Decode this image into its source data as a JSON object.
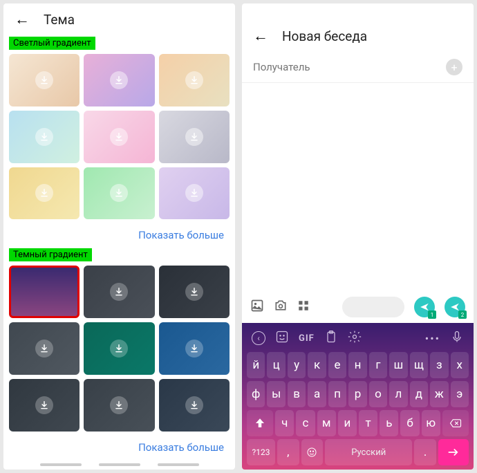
{
  "left": {
    "title": "Тема",
    "sections": {
      "light": {
        "label": "Светлый градиент",
        "more": "Показать больше"
      },
      "dark": {
        "label": "Темный градиент",
        "more": "Показать больше"
      }
    }
  },
  "right": {
    "title": "Новая беседа",
    "recipient_placeholder": "Получатель",
    "send_badges": [
      "1",
      "2"
    ],
    "keyboard": {
      "toolbar": {
        "gif": "GIF"
      },
      "row1": [
        "й",
        "ц",
        "у",
        "к",
        "е",
        "н",
        "г",
        "ш",
        "щ",
        "з",
        "х"
      ],
      "row2": [
        "ф",
        "ы",
        "в",
        "а",
        "п",
        "р",
        "о",
        "л",
        "д",
        "ж",
        "э"
      ],
      "row3": [
        "ч",
        "с",
        "м",
        "и",
        "т",
        "ь",
        "б",
        "ю"
      ],
      "row4": {
        "sym": "?123",
        "comma": ",",
        "space": "Русский",
        "dot": "."
      }
    }
  },
  "tiles": {
    "light": [
      "linear-gradient(135deg,#f5e6d3,#e8c8a8)",
      "linear-gradient(135deg,#e8b0d8,#b8a8e8)",
      "linear-gradient(135deg,#f5d0a8,#e8e0c0)",
      "linear-gradient(135deg,#b8e0f0,#d0f0e0)",
      "linear-gradient(135deg,#f8d8e8,#f5b5d5)",
      "linear-gradient(135deg,#d8d8e0,#b8b8c8)",
      "linear-gradient(135deg,#f0d890,#f5e8b0)",
      "linear-gradient(135deg,#a0e8b0,#c8f0d0)",
      "linear-gradient(135deg,#e0d0f0,#c8b8e8)"
    ],
    "dark": [
      "linear-gradient(180deg,#3a2a70,#8a4580)",
      "linear-gradient(135deg,#3a4048,#4a5058)",
      "linear-gradient(135deg,#2a3038,#3a4048)",
      "linear-gradient(135deg,#404850,#505860)",
      "linear-gradient(135deg,#0a6858,#0a7868)",
      "linear-gradient(135deg,#1a5890,#2a68a0)",
      "linear-gradient(135deg,#303840,#404850)",
      "linear-gradient(135deg,#384048,#485058)",
      "linear-gradient(135deg,#2a3848,#3a4858)"
    ]
  }
}
